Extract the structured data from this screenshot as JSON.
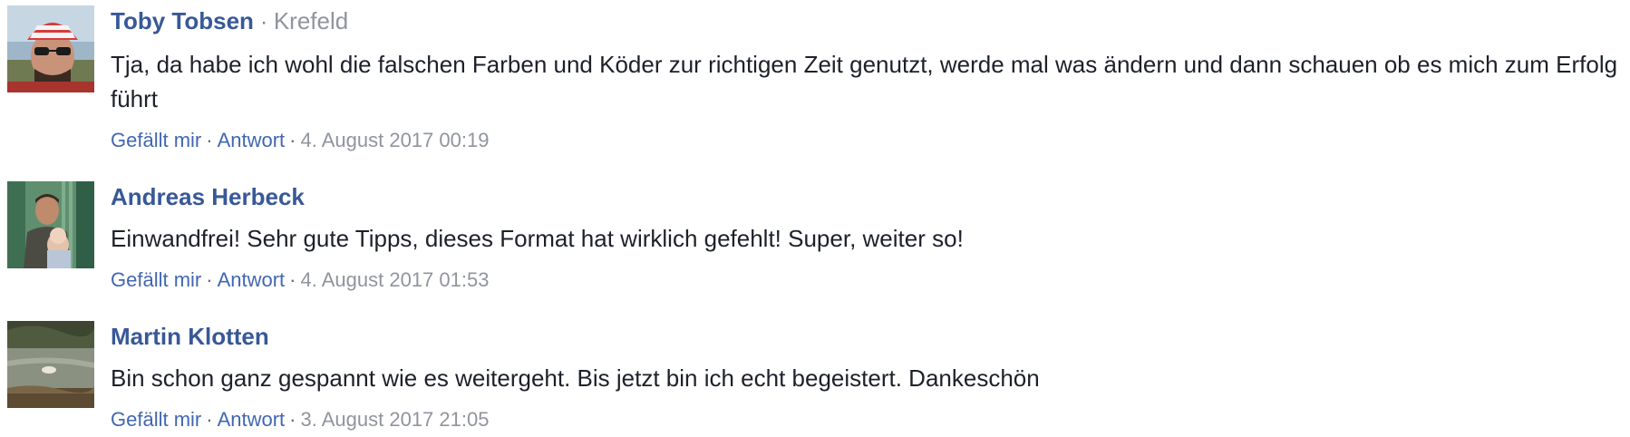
{
  "comments": [
    {
      "author": "Toby Tobsen",
      "location": "Krefeld",
      "separator": "·",
      "text": "Tja, da habe ich wohl die falschen Farben und Köder zur richtigen Zeit genutzt, werde mal was ändern und dann schauen ob es mich zum Erfolg führt",
      "like_label": "Gefällt mir",
      "reply_label": "Antwort",
      "timestamp": "4. August 2017 00:19",
      "avatar_icon": "profile-photo-man-in-striped-cap-and-sunglasses"
    },
    {
      "author": "Andreas Herbeck",
      "text": "Einwandfrei! Sehr gute Tipps, dieses Format hat wirklich gefehlt! Super, weiter so!",
      "like_label": "Gefällt mir",
      "reply_label": "Antwort",
      "timestamp": "4. August 2017 01:53",
      "avatar_icon": "profile-photo-man-holding-baby"
    },
    {
      "author": "Martin Klotten",
      "text": "Bin schon ganz gespannt wie es weitergeht. Bis jetzt bin ich echt begeistert. Dankeschön",
      "like_label": "Gefällt mir",
      "reply_label": "Antwort",
      "timestamp": "3. August 2017 21:05",
      "avatar_icon": "profile-photo-river-landscape"
    }
  ],
  "action_separator": "·",
  "colors": {
    "author": "#385898",
    "link": "#4267b2",
    "muted": "#90949c",
    "text": "#1d2129"
  }
}
